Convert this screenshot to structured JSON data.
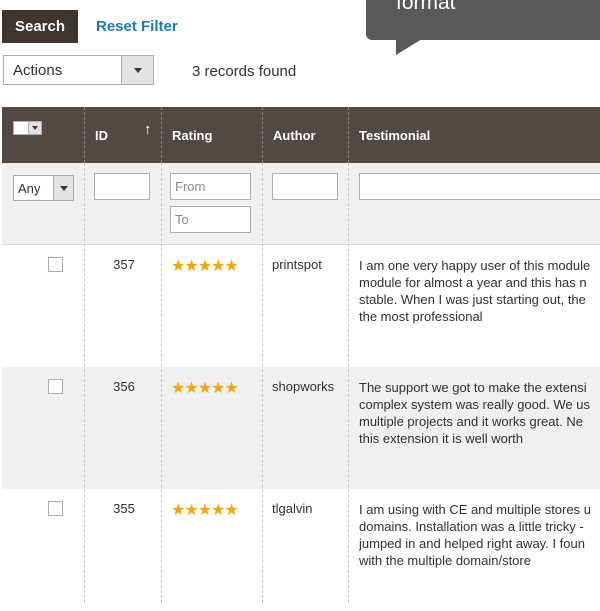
{
  "toolbar": {
    "search_label": "Search",
    "reset_label": "Reset Filter",
    "actions_label": "Actions",
    "records_found": "3 records found"
  },
  "tooltip": {
    "text": "format"
  },
  "grid": {
    "headers": {
      "id": "ID",
      "sort_indicator": "↑",
      "rating": "Rating",
      "author": "Author",
      "testimonial": "Testimonial"
    },
    "filters": {
      "any_label": "Any",
      "rating_from_placeholder": "From",
      "rating_to_placeholder": "To"
    },
    "rows": [
      {
        "id": "357",
        "rating": 5,
        "author": "printspot",
        "testimonial": "I am one very happy user of this module\nmodule for almost a year and this has n\nstable. When I was just starting out, the\nthe most professional"
      },
      {
        "id": "356",
        "rating": 5,
        "author": "shopworks",
        "testimonial": "The support we got to make the extensi\ncomplex system was really good. We us\nmultiple projects and it works great. Ne\nthis extension it is well worth"
      },
      {
        "id": "355",
        "rating": 5,
        "author": "tlgalvin",
        "testimonial": "I am using with CE and multiple stores u\ndomains. Installation was a little tricky -\njumped in and helped right away. I foun\nwith the multiple domain/store"
      }
    ]
  },
  "icons": {
    "star": "star-icon",
    "dropdown": "chevron-down-icon",
    "sort": "sort-ascending-icon"
  },
  "colors": {
    "header_bg": "#514943",
    "button_bg": "#41362f",
    "link": "#1979c3",
    "star": "#f7a600",
    "tooltip_bg": "#595959",
    "row_alt": "#f0f0f0"
  }
}
